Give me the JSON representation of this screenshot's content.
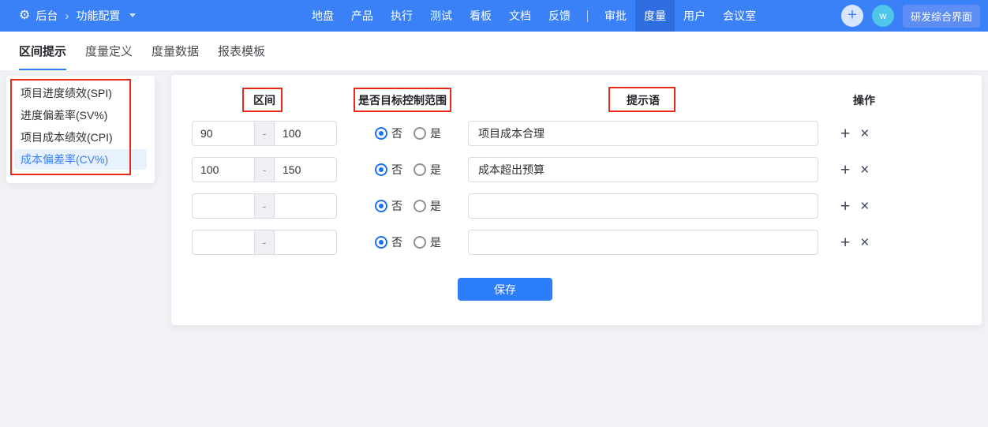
{
  "icons": {
    "gear": "⚙",
    "breadcrumb_chevron": "›",
    "plus": "+",
    "close": "×",
    "avatar_plus": "+"
  },
  "topbar": {
    "home_label": "后台",
    "module_label": "功能配置",
    "nav_items": [
      "地盘",
      "产品",
      "执行",
      "测试",
      "看板",
      "文档",
      "反馈",
      "审批",
      "度量",
      "用户",
      "会议室"
    ],
    "active_nav": "度量",
    "avatar_label": "w",
    "workspace_button_label": "研发综合界面"
  },
  "tabs": {
    "items": [
      "区间提示",
      "度量定义",
      "度量数据",
      "报表模板"
    ],
    "active": "区间提示"
  },
  "sidebar": {
    "items": [
      {
        "label": "项目进度绩效(SPI)",
        "selected": false
      },
      {
        "label": "进度偏差率(SV%)",
        "selected": false
      },
      {
        "label": "项目成本绩效(CPI)",
        "selected": false
      },
      {
        "label": "成本偏差率(CV%)",
        "selected": true
      }
    ]
  },
  "panel": {
    "headers": {
      "range": "区间",
      "target_control": "是否目标控制范围",
      "prompt": "提示语",
      "operations": "操作"
    },
    "range_separator": "-",
    "radio_options": {
      "no": "否",
      "yes": "是"
    },
    "rows": [
      {
        "min": "90",
        "max": "100",
        "target_control": "否",
        "prompt": "项目成本合理"
      },
      {
        "min": "100",
        "max": "150",
        "target_control": "否",
        "prompt": "成本超出预算"
      },
      {
        "min": "",
        "max": "",
        "target_control": "否",
        "prompt": ""
      },
      {
        "min": "",
        "max": "",
        "target_control": "否",
        "prompt": ""
      }
    ],
    "save_button_label": "保存"
  },
  "colors": {
    "topbar_bg": "#3a80f7",
    "topbar_active_bg": "#2f6ee0",
    "accent_blue": "#2b7ef8",
    "avatar_bg": "#4fc6e8",
    "selected_item_bg": "#e8f1fe",
    "annotation_red": "#e8291c",
    "page_bg": "#f0f2f5"
  }
}
